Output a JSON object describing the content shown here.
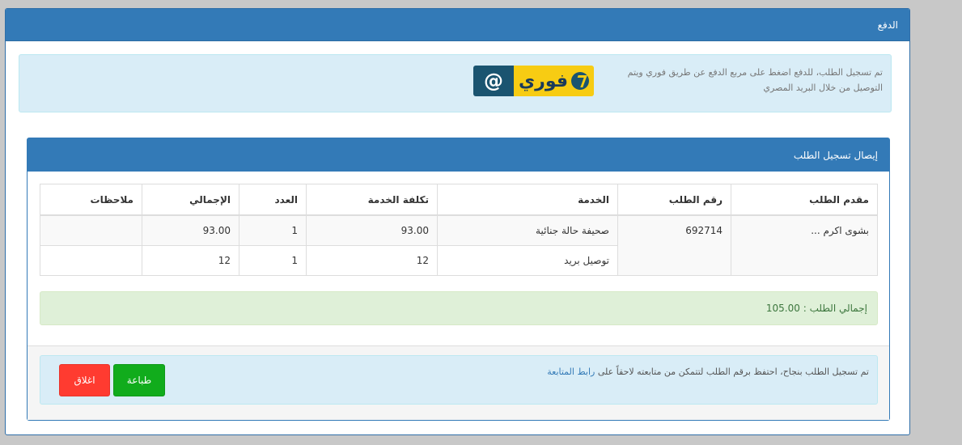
{
  "modal": {
    "title": "الدفع"
  },
  "info": {
    "text": "تم تسجيل الطلب، للدفع اضغط على مربع الدفع عن طريق فوري ويتم التوصيل من خلال البريد المصري",
    "fawry_at": "@",
    "fawry_name": "فوري"
  },
  "panel": {
    "title": "إيصال تسجيل الطلب",
    "table": {
      "headers": [
        "مقدم الطلب",
        "رقم الطلب",
        "الخدمة",
        "تكلفة الخدمة",
        "العدد",
        "الإجمالي",
        "ملاحظات"
      ],
      "applicant": "بشوى اكرم ...",
      "order_number": "692714",
      "rows": [
        {
          "service": "صحيفة حالة جنائية",
          "cost": "93.00",
          "count": "1",
          "total": "93.00",
          "notes": ""
        },
        {
          "service": "توصيل بريد",
          "cost": "12",
          "count": "1",
          "total": "12",
          "notes": ""
        }
      ]
    },
    "grand_total": "إجمالي الطلب : 105.00"
  },
  "footer": {
    "message": "تم تسجيل الطلب بنجاح، احتفظ برقم الطلب لتتمكن من متابعته لاحقاً على",
    "link_text": "رابط المتابعة",
    "print_label": "طباعة",
    "close_label": "اغلاق"
  },
  "colors": {
    "primary": "#337ab7",
    "info_bg": "#d9edf7",
    "success_bg": "#dff0d8",
    "print_button": "#11ac1c",
    "close_button": "#ff3b30"
  }
}
